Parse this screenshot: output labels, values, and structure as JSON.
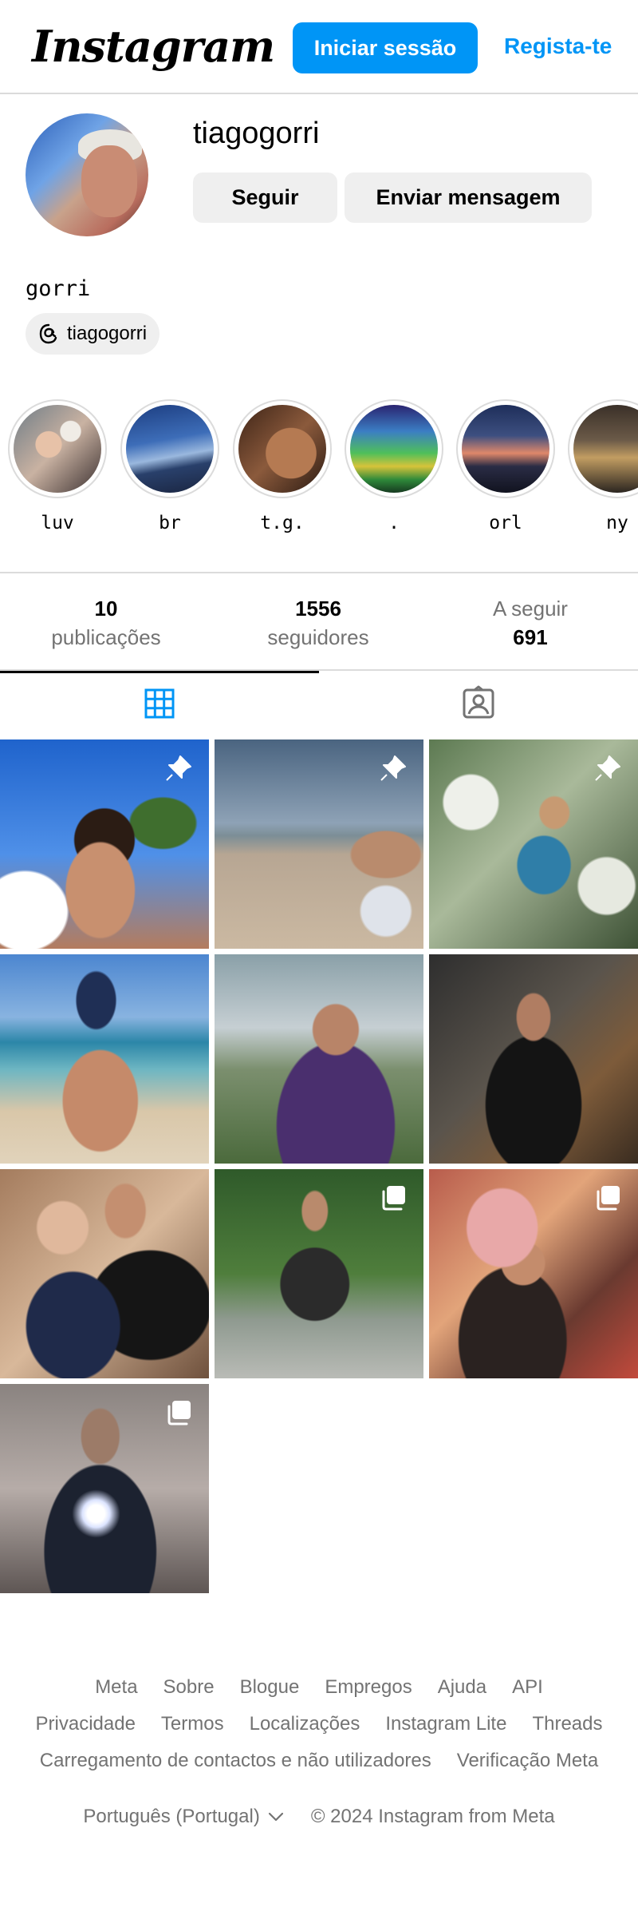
{
  "header": {
    "logo": "Instagram",
    "login_label": "Iniciar sessão",
    "signup_label": "Regista-te"
  },
  "profile": {
    "username": "tiagogorri",
    "follow_label": "Seguir",
    "message_label": "Enviar mensagem",
    "full_name": "gorri",
    "threads_handle": "tiagogorri"
  },
  "highlights": [
    {
      "label": "luv",
      "icon": "highlight-cover"
    },
    {
      "label": "br",
      "icon": "highlight-cover"
    },
    {
      "label": "t.g.",
      "icon": "highlight-cover"
    },
    {
      "label": ".",
      "icon": "highlight-cover"
    },
    {
      "label": "orl",
      "icon": "highlight-cover"
    },
    {
      "label": "ny",
      "icon": "highlight-cover"
    }
  ],
  "stats": {
    "posts_count": "10",
    "posts_label": "publicações",
    "followers_count": "1556",
    "followers_label": "seguidores",
    "following_label": "A seguir",
    "following_count": "691"
  },
  "tabs": [
    {
      "name": "posts",
      "icon": "grid-icon",
      "active": true
    },
    {
      "name": "tagged",
      "icon": "tagged-icon",
      "active": false
    }
  ],
  "posts": [
    {
      "badge": "pin-icon"
    },
    {
      "badge": "pin-icon"
    },
    {
      "badge": "pin-icon"
    },
    {
      "badge": ""
    },
    {
      "badge": ""
    },
    {
      "badge": ""
    },
    {
      "badge": ""
    },
    {
      "badge": "carousel-icon"
    },
    {
      "badge": "carousel-icon"
    },
    {
      "badge": "carousel-icon"
    }
  ],
  "footer": {
    "links_row1": [
      "Meta",
      "Sobre",
      "Blogue",
      "Empregos",
      "Ajuda",
      "API"
    ],
    "links_row2": [
      "Privacidade",
      "Termos",
      "Localizações",
      "Instagram Lite",
      "Threads"
    ],
    "links_row3": [
      "Carregamento de contactos e não utilizadores",
      "Verificação Meta"
    ],
    "language": "Português (Portugal)",
    "copyright": "© 2024 Instagram from Meta"
  },
  "colors": {
    "accent": "#0095f6",
    "secondary_text": "#737373",
    "button_bg": "#efefef",
    "border": "#dbdbdb"
  }
}
